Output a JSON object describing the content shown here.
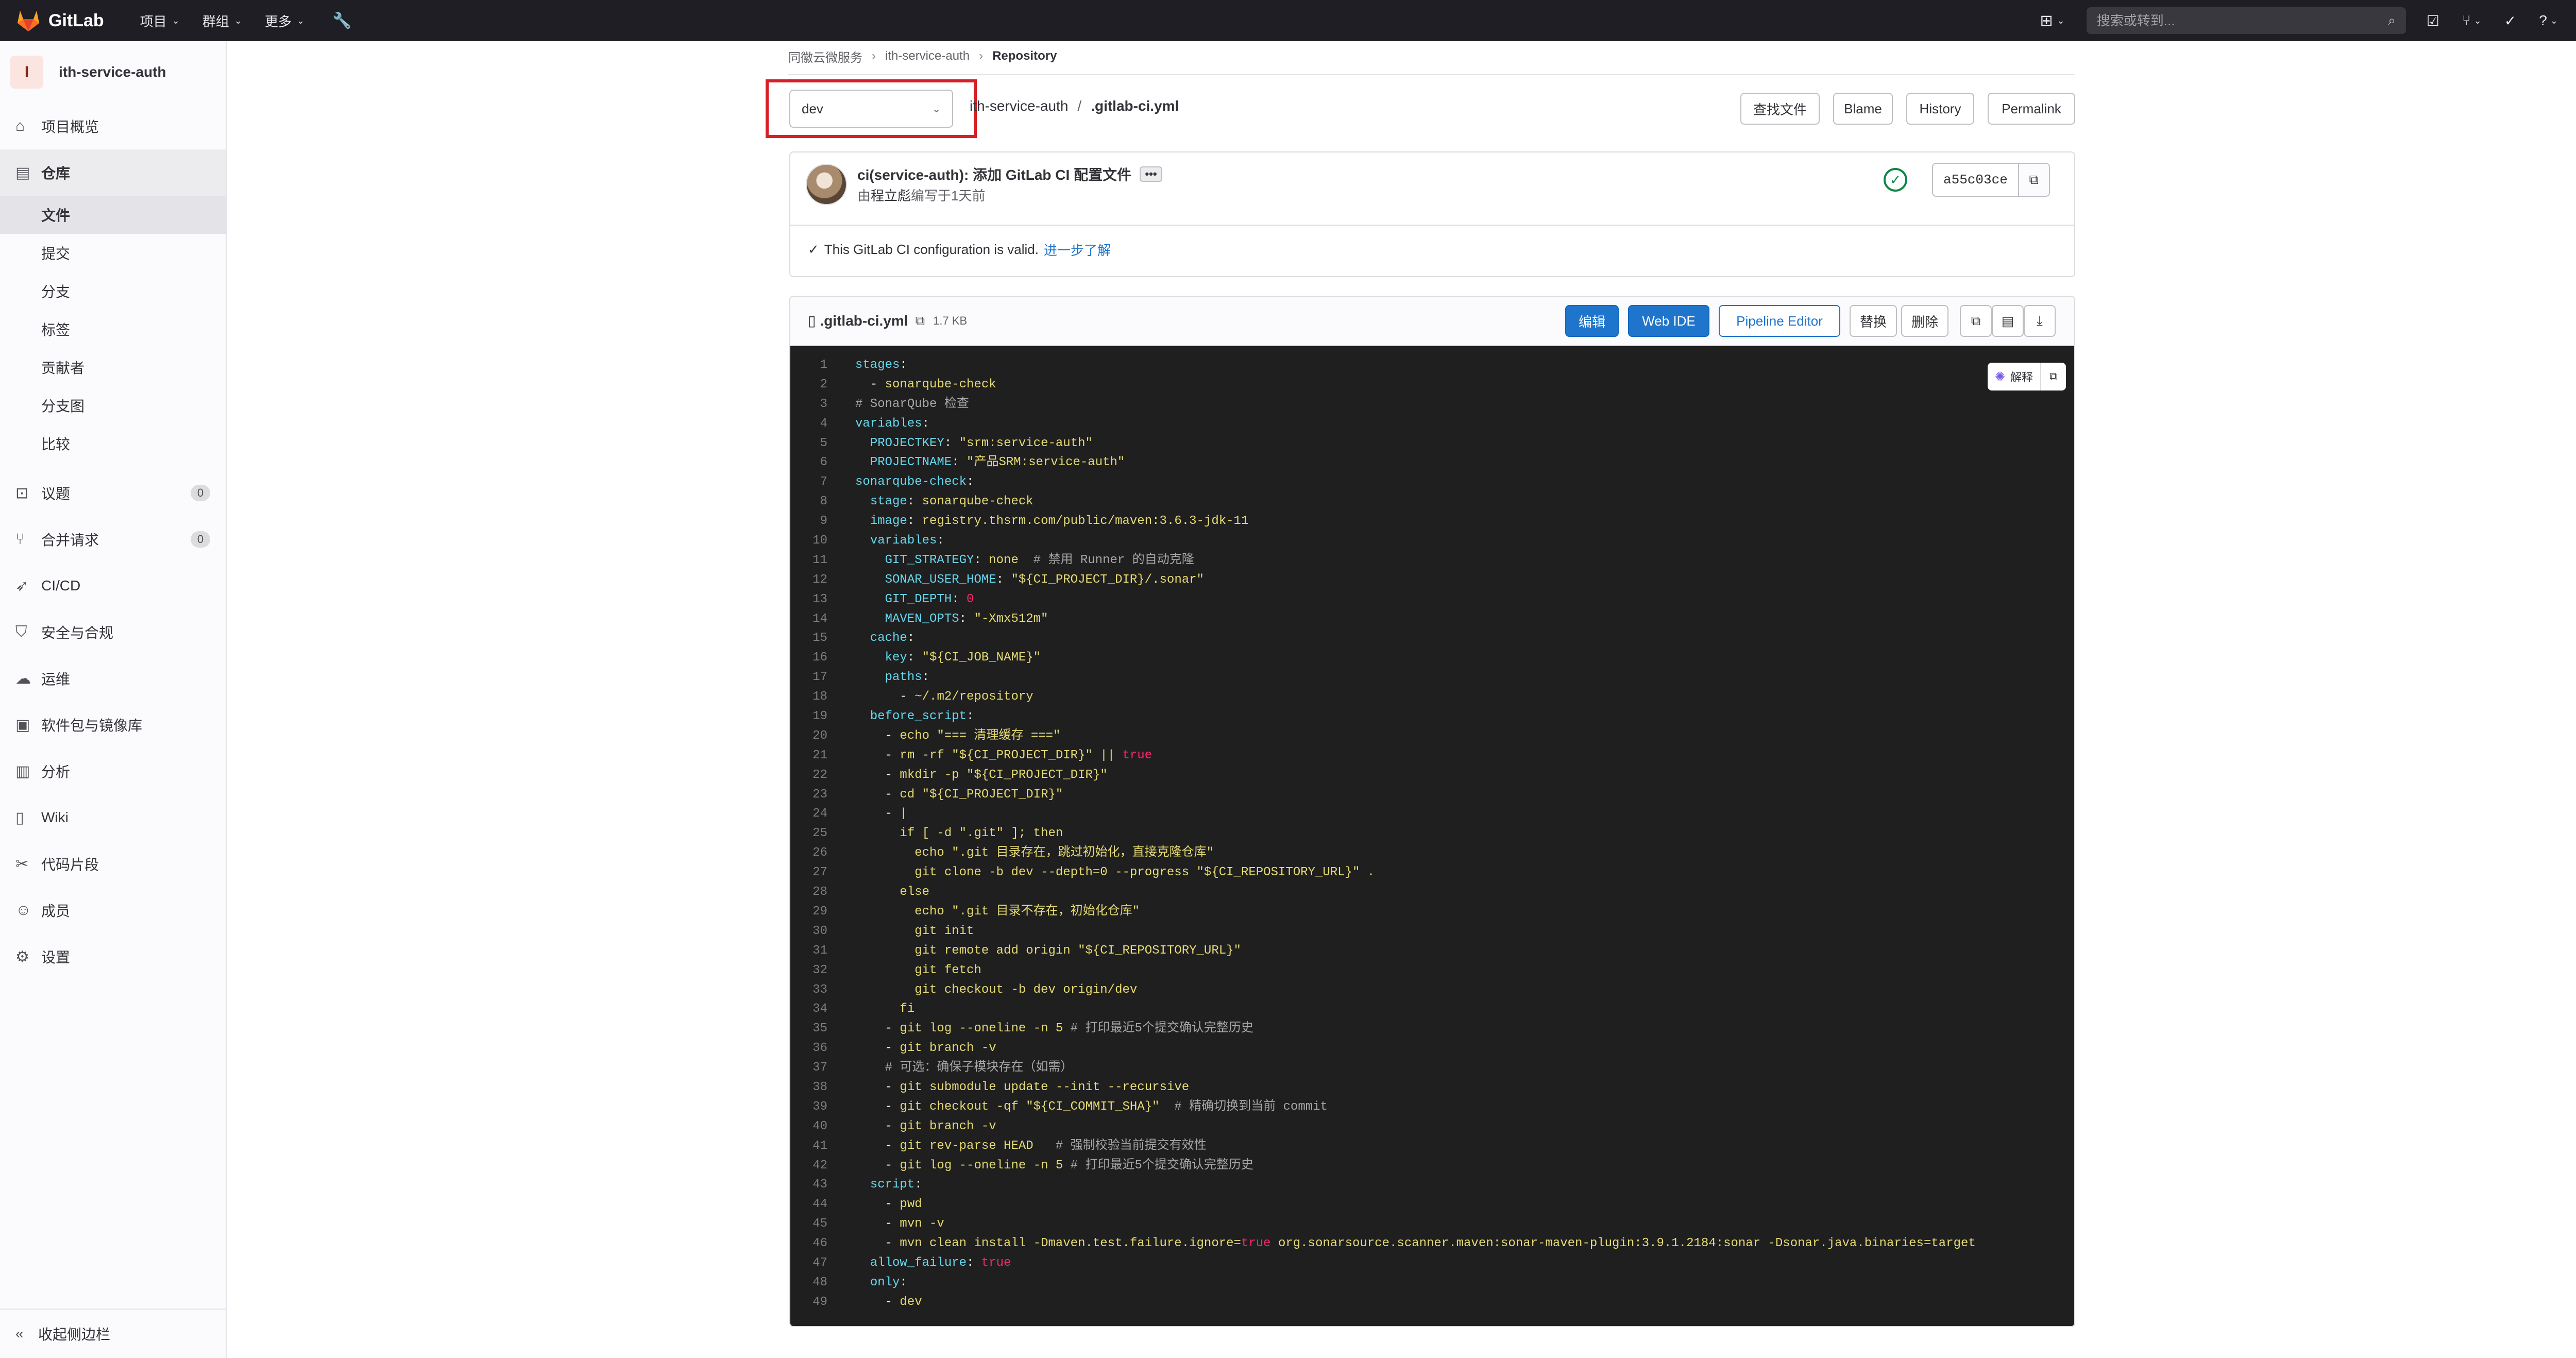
{
  "topbar": {
    "logo_text": "GitLab",
    "menus": [
      "项目",
      "群组",
      "更多"
    ],
    "search_placeholder": "搜索或转到..."
  },
  "sidebar": {
    "project_initial": "I",
    "project_name": "ith-service-auth",
    "items": [
      {
        "label": "项目概览",
        "icon": "home-icon"
      },
      {
        "label": "仓库",
        "icon": "repository-icon"
      },
      {
        "label": "议题",
        "icon": "issues-icon",
        "count": "0"
      },
      {
        "label": "合并请求",
        "icon": "merge-request-icon",
        "count": "0"
      },
      {
        "label": "CI/CD",
        "icon": "rocket-icon"
      },
      {
        "label": "安全与合规",
        "icon": "shield-icon"
      },
      {
        "label": "运维",
        "icon": "deployments-icon"
      },
      {
        "label": "软件包与镜像库",
        "icon": "package-icon"
      },
      {
        "label": "分析",
        "icon": "chart-icon"
      },
      {
        "label": "Wiki",
        "icon": "book-icon"
      },
      {
        "label": "代码片段",
        "icon": "scissors-icon"
      },
      {
        "label": "成员",
        "icon": "users-icon"
      },
      {
        "label": "设置",
        "icon": "settings-icon"
      }
    ],
    "repo_sub": [
      "文件",
      "提交",
      "分支",
      "标签",
      "贡献者",
      "分支图",
      "比较"
    ],
    "collapse_label": "收起侧边栏"
  },
  "breadcrumb": [
    "同徽云微服务",
    "ith-service-auth",
    "Repository"
  ],
  "file_nav": {
    "branch": "dev",
    "project_path": "ith-service-auth",
    "file_name": ".gitlab-ci.yml",
    "buttons": [
      "查找文件",
      "Blame",
      "History",
      "Permalink"
    ]
  },
  "commit": {
    "title": "ci(service-auth): 添加 GitLab CI 配置文件",
    "more": "•••",
    "author_prefix": "由",
    "author": "程立彪",
    "time": "编写于1天前",
    "sha": "a55c03ce",
    "ci_valid": "This GitLab CI configuration is valid.",
    "ci_link": "进一步了解"
  },
  "file": {
    "name": ".gitlab-ci.yml",
    "size": "1.7 KB",
    "buttons": [
      "编辑",
      "Web IDE",
      "Pipeline Editor",
      "替换",
      "删除"
    ],
    "explain_label": "解释"
  },
  "code_lines": [
    "stages:",
    "  - sonarqube-check",
    "# SonarQube 检查",
    "variables:",
    "  PROJECTKEY: \"srm:service-auth\"",
    "  PROJECTNAME: \"产品SRM:service-auth\"",
    "sonarqube-check:",
    "  stage: sonarqube-check",
    "  image: registry.thsrm.com/public/maven:3.6.3-jdk-11",
    "  variables:",
    "    GIT_STRATEGY: none  # 禁用 Runner 的自动克隆",
    "    SONAR_USER_HOME: \"${CI_PROJECT_DIR}/.sonar\"",
    "    GIT_DEPTH: 0",
    "    MAVEN_OPTS: \"-Xmx512m\"",
    "  cache:",
    "    key: \"${CI_JOB_NAME}\"",
    "    paths:",
    "      - ~/.m2/repository",
    "  before_script:",
    "    - echo \"=== 清理缓存 ===\"",
    "    - rm -rf \"${CI_PROJECT_DIR}\" || true",
    "    - mkdir -p \"${CI_PROJECT_DIR}\"",
    "    - cd \"${CI_PROJECT_DIR}\"",
    "    - |",
    "      if [ -d \".git\" ]; then",
    "        echo \".git 目录存在，跳过初始化，直接克隆仓库\"",
    "        git clone -b dev --depth=0 --progress \"${CI_REPOSITORY_URL}\" .",
    "      else",
    "        echo \".git 目录不存在，初始化仓库\"",
    "        git init",
    "        git remote add origin \"${CI_REPOSITORY_URL}\"",
    "        git fetch",
    "        git checkout -b dev origin/dev",
    "      fi",
    "    - git log --oneline -n 5 # 打印最近5个提交确认完整历史",
    "    - git branch -v",
    "    # 可选：确保子模块存在（如需）",
    "    - git submodule update --init --recursive",
    "    - git checkout -qf \"${CI_COMMIT_SHA}\"  # 精确切换到当前 commit",
    "    - git branch -v",
    "    - git rev-parse HEAD   # 强制校验当前提交有效性",
    "    - git log --oneline -n 5 # 打印最近5个提交确认完整历史",
    "  script:",
    "    - pwd",
    "    - mvn -v",
    "    - mvn clean install -Dmaven.test.failure.ignore=true org.sonarsource.scanner.maven:sonar-maven-plugin:3.9.1.2184:sonar -Dsonar.java.binaries=target",
    "  allow_failure: true",
    "  only:",
    "    - dev"
  ],
  "colors": {
    "topbar": "#1f1e24",
    "brand_orange": "#fc6d26",
    "primary_blue": "#1f75cb",
    "highlight_red": "#d61f26",
    "pipeline_success": "#108548",
    "code_bg": "#1f1f1f"
  }
}
